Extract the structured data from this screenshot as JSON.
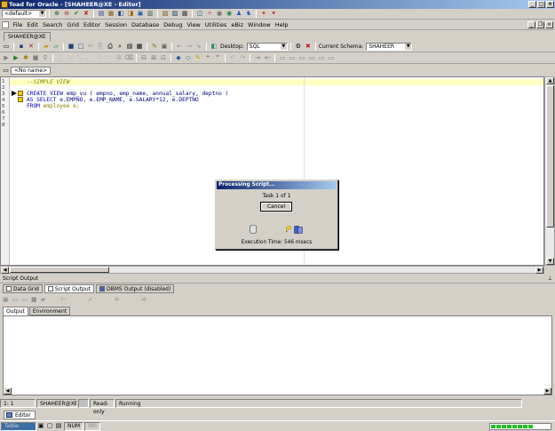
{
  "window": {
    "title": "Toad for Oracle - [SHAHEER@XE - Editor]"
  },
  "toolbar1": {
    "connection_combo": "<default>"
  },
  "menu": {
    "items": [
      "File",
      "Edit",
      "Search",
      "Grid",
      "Editor",
      "Session",
      "Database",
      "Debug",
      "View",
      "Utilities",
      "eBiz",
      "Window",
      "Help"
    ]
  },
  "connection_tab": {
    "label": "SHAHEER@XE"
  },
  "toolbar3": {
    "desktop_label": "Desktop:",
    "desktop_value": "SQL",
    "schema_label": "Current Schema:",
    "schema_value": "SHAHEER"
  },
  "editor": {
    "tab_label": "<No name>",
    "line_numbers": [
      "1",
      "2",
      "3",
      "4",
      "5",
      "6",
      "7",
      "8"
    ],
    "lines": {
      "l1_comment": "--SIMPLE VIEW",
      "l3_kw": "CREATE VIEW",
      "l3_rest": " emp_vu ( empno, emp_name, annual_salary, deptno )",
      "l4_kw": "AS SELECT",
      "l4_rest": " e.EMPNO, e.EMP_NAME, e.SALARY*12, e.DEPTNO",
      "l5_kw": "FROM",
      "l5_rest": " employee e;"
    }
  },
  "output_panel": {
    "title": "Script Output",
    "tabs": [
      "Data Grid",
      "Script Output",
      "DBMS Output (disabled)"
    ],
    "subtabs": [
      "Output",
      "Environment"
    ]
  },
  "status": {
    "position": "1:   1",
    "connection": "SHAHEER@XE",
    "mode": "Read-only",
    "state": "Running"
  },
  "bottom_tab": {
    "label": "Editor"
  },
  "taskbar": {
    "item1": "Table: SCO",
    "num": "NUM",
    "ins": "INS"
  },
  "dialog": {
    "title": "Processing Script...",
    "task": "Task 1 of 1",
    "cancel_label": "Cancel",
    "execution": "Execution Time: 546 msecs"
  },
  "colors": {
    "titlebar_start": "#0a246a",
    "titlebar_end": "#a6caf0",
    "keyword": "#0000c0",
    "comment": "#808000",
    "current_line": "#ffffc0",
    "progress": "#20c020"
  }
}
